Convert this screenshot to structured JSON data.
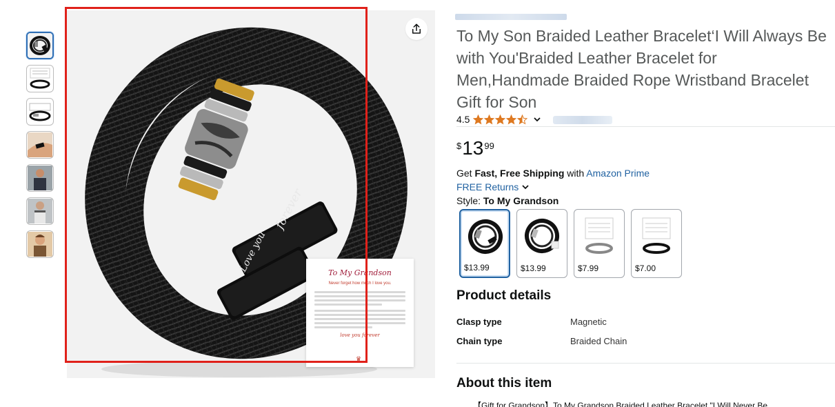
{
  "product": {
    "title": "To My Son Braided Leather Bracelet‘I Will Always Be with You'Braided Leather Bracelet for Men,Handmade Braided Rope Wristband Bracelet Gift for Son",
    "rating": "4.5",
    "rating_value": 4.5,
    "price": {
      "symbol": "$",
      "whole": "13",
      "fraction": "99"
    }
  },
  "image": {
    "engraving_1": "forever",
    "engraving_2": "Love you",
    "card": {
      "title": "To My Grandson",
      "subtitle": "Never forget how much I love you.",
      "signature": "love you forever"
    }
  },
  "thumbnails": [
    {
      "name": "bracelet",
      "active": true
    },
    {
      "name": "bracelet-card"
    },
    {
      "name": "bracelet-box"
    },
    {
      "name": "wrist"
    },
    {
      "name": "man-1"
    },
    {
      "name": "man-2"
    },
    {
      "name": "man-3"
    }
  ],
  "shipping": {
    "prefix": "Get ",
    "bold": "Fast, Free Shipping",
    "middle": " with ",
    "link": "Amazon Prime"
  },
  "returns": {
    "label": "FREE Returns"
  },
  "style": {
    "label": "Style: ",
    "value": "To My Grandson"
  },
  "variants": [
    {
      "price": "$13.99",
      "selected": true
    },
    {
      "price": "$13.99"
    },
    {
      "price": "$7.99"
    },
    {
      "price": "$7.00"
    }
  ],
  "product_details": {
    "heading": "Product details",
    "rows": [
      {
        "key": "Clasp type",
        "value": "Magnetic"
      },
      {
        "key": "Chain type",
        "value": "Braided Chain"
      }
    ]
  },
  "about": {
    "heading": "About this item",
    "first_bullet_partial": "【Gift for Grandson】To My Grandson Braided Leather Bracelet \"I Will Never Be"
  },
  "colors": {
    "link": "#2162a1",
    "star": "#de7921",
    "highlight": "#e0211a"
  }
}
